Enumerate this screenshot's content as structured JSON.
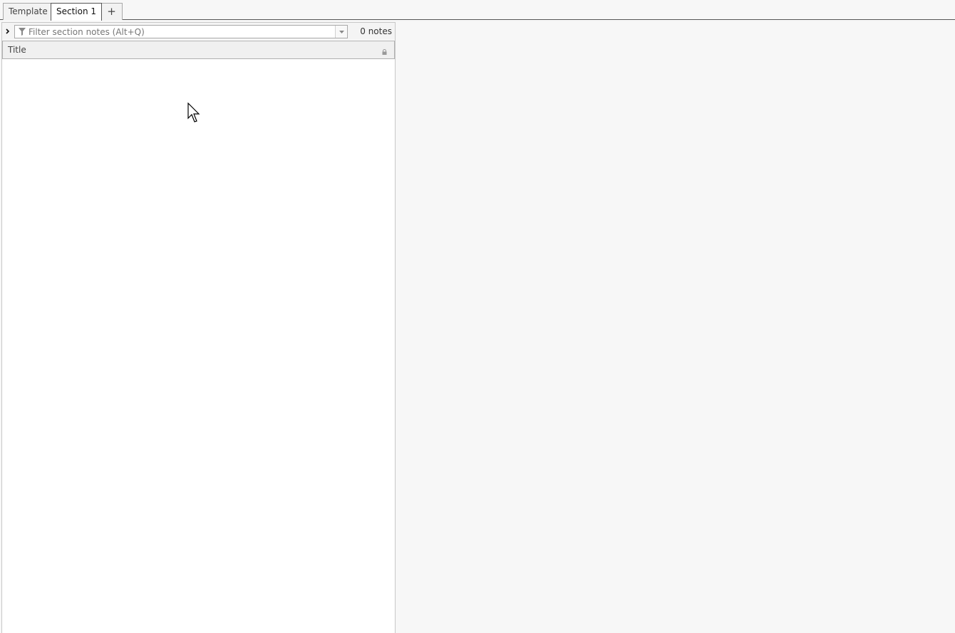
{
  "tabs": [
    {
      "label": "Template",
      "active": false
    },
    {
      "label": "Section 1",
      "active": true
    }
  ],
  "add_tab_label": "+",
  "filter": {
    "placeholder": "Filter section notes (Alt+Q)",
    "value": ""
  },
  "note_count": "0 notes",
  "columns": {
    "title": "Title"
  },
  "icons": {
    "expand": "chevron-right-icon",
    "filter": "funnel-icon",
    "dropdown": "chevron-down-icon",
    "lock": "lock-icon"
  },
  "colors": {
    "panel_bg": "#ffffff",
    "window_bg": "#f7f7f7",
    "header_bg": "#f0f0f0",
    "border": "#a9a9a9"
  }
}
